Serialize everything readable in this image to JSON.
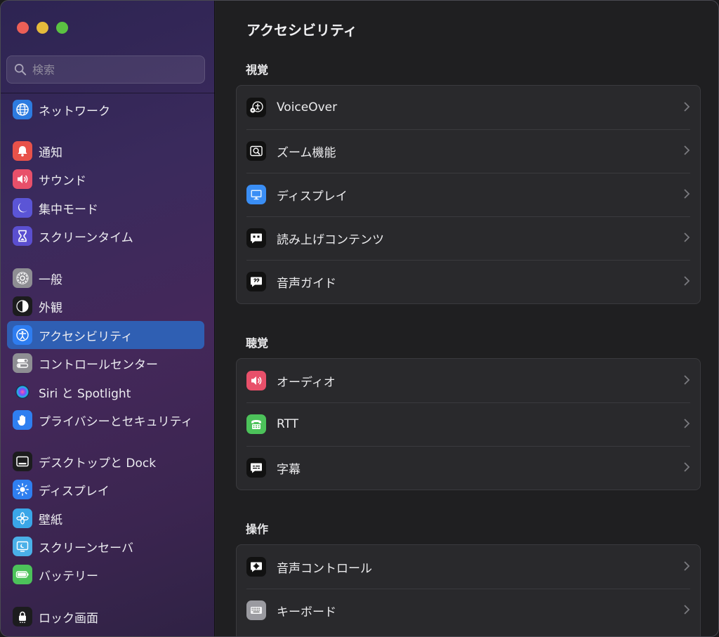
{
  "sidebar": {
    "search_placeholder": "検索",
    "items": [
      {
        "label": "ネットワーク",
        "icon": "globe-icon",
        "color": "#2d7be0"
      },
      {
        "label": "通知",
        "icon": "bell-icon",
        "color": "#e8524a"
      },
      {
        "label": "サウンド",
        "icon": "speaker-icon",
        "color": "#e8506a"
      },
      {
        "label": "集中モード",
        "icon": "moon-icon",
        "color": "#5b55d6"
      },
      {
        "label": "スクリーンタイム",
        "icon": "hourglass-icon",
        "color": "#5b4fd0"
      },
      {
        "label": "一般",
        "icon": "gear-icon",
        "color": "#8e8e93"
      },
      {
        "label": "外観",
        "icon": "appearance-icon",
        "color": "#1c1c1e"
      },
      {
        "label": "アクセシビリティ",
        "icon": "accessibility-icon",
        "color": "#2e7df0",
        "active": true
      },
      {
        "label": "コントロールセンター",
        "icon": "toggles-icon",
        "color": "#8e8e93"
      },
      {
        "label": "Siri と Spotlight",
        "icon": "siri-icon",
        "color": "#222"
      },
      {
        "label": "プライバシーとセキュリティ",
        "icon": "hand-icon",
        "color": "#2f7ff0"
      },
      {
        "label": "デスクトップと Dock",
        "icon": "dock-icon",
        "color": "#1c1c1e"
      },
      {
        "label": "ディスプレイ",
        "icon": "sun-icon",
        "color": "#2f7ff0"
      },
      {
        "label": "壁紙",
        "icon": "flower-icon",
        "color": "#3aa6e8"
      },
      {
        "label": "スクリーンセーバ",
        "icon": "screensaver-icon",
        "color": "#4ab0e8"
      },
      {
        "label": "バッテリー",
        "icon": "battery-icon",
        "color": "#4cc25a"
      },
      {
        "label": "ロック画面",
        "icon": "lock-icon",
        "color": "#1c1c1e"
      }
    ]
  },
  "main": {
    "title": "アクセシビリティ",
    "sections": [
      {
        "title": "視覚",
        "rows": [
          {
            "label": "VoiceOver",
            "icon": "voiceover-icon"
          },
          {
            "label": "ズーム機能",
            "icon": "zoom-icon"
          },
          {
            "label": "ディスプレイ",
            "icon": "display-icon"
          },
          {
            "label": "読み上げコンテンツ",
            "icon": "spoken-content-icon"
          },
          {
            "label": "音声ガイド",
            "icon": "audio-description-icon"
          }
        ]
      },
      {
        "title": "聴覚",
        "rows": [
          {
            "label": "オーディオ",
            "icon": "audio-icon"
          },
          {
            "label": "RTT",
            "icon": "rtt-icon"
          },
          {
            "label": "字幕",
            "icon": "captions-icon"
          }
        ]
      },
      {
        "title": "操作",
        "rows": [
          {
            "label": "音声コントロール",
            "icon": "voice-control-icon"
          },
          {
            "label": "キーボード",
            "icon": "keyboard-icon"
          }
        ]
      }
    ]
  }
}
